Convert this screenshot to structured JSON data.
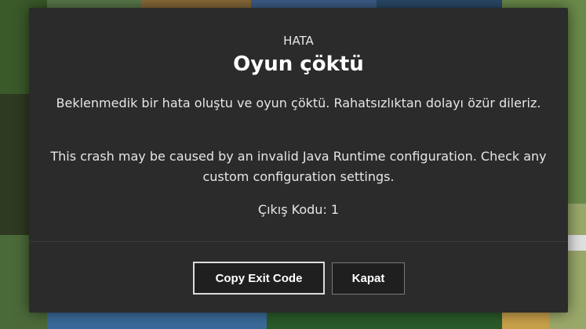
{
  "dialog": {
    "kicker": "HATA",
    "title": "Oyun çöktü",
    "message": "Beklenmedik bir hata oluştu ve oyun çöktü. Rahatsızlıktan dolayı özür dileriz.",
    "hint": "This crash may be caused by an invalid Java Runtime configuration. Check any custom configuration settings.",
    "exit_code": "Çıkış Kodu: 1",
    "copy_button_label": "Copy Exit Code",
    "close_button_label": "Kapat"
  },
  "colors": {
    "dialog_bg": "#2b2b2b",
    "button_bg": "#1f1f1f",
    "focus_border": "#dcdcdc",
    "text": "#ffffff"
  }
}
